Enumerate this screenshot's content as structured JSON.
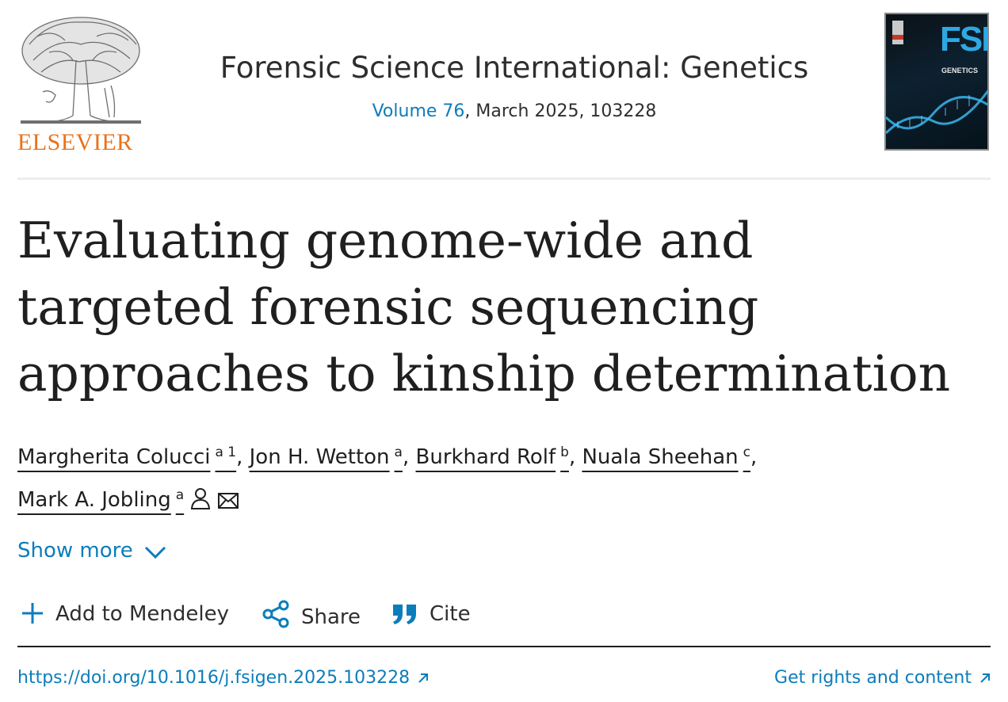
{
  "header": {
    "publisher": "ELSEVIER",
    "journal_title": "Forensic Science International: Genetics",
    "volume_link": "Volume 76",
    "issue_rest": ", March 2025, 103228",
    "cover_title": "FSI",
    "cover_subtitle": "GENETICS"
  },
  "article": {
    "title": "Evaluating genome-wide and targeted forensic sequencing approaches to kinship determination",
    "authors": [
      {
        "name": "Margherita Colucci",
        "affil": "a 1"
      },
      {
        "name": "Jon H. Wetton",
        "affil": "a"
      },
      {
        "name": "Burkhard Rolf",
        "affil": "b"
      },
      {
        "name": "Nuala Sheehan",
        "affil": "c"
      },
      {
        "name": "Mark A. Jobling",
        "affil": "a"
      }
    ],
    "separator": ","
  },
  "show_more": "Show more",
  "toolbar": {
    "mendeley": "Add to Mendeley",
    "share": "Share",
    "cite": "Cite"
  },
  "links": {
    "doi": "https://doi.org/10.1016/j.fsigen.2025.103228",
    "rights": "Get rights and content"
  },
  "colors": {
    "link": "#0c7dbb",
    "publisher_orange": "#e9711c",
    "text": "#1f1f1f"
  },
  "icons": {
    "author_contact": "person-icon",
    "author_email": "envelope-icon",
    "show_more": "chevron-down-icon",
    "mendeley": "plus-icon",
    "share": "share-icon",
    "cite": "quote-icon",
    "external": "external-link-icon"
  }
}
